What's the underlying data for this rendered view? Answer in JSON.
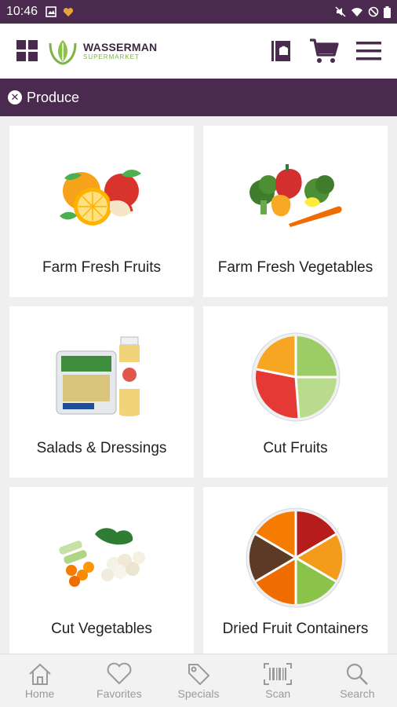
{
  "status_bar": {
    "time": "10:46"
  },
  "header": {
    "logo_name": "WASSERMAN",
    "logo_sub": "SUPERMARKET"
  },
  "breadcrumb": {
    "label": "Produce"
  },
  "categories": [
    {
      "label": "Farm Fresh Fruits"
    },
    {
      "label": "Farm Fresh Vegetables"
    },
    {
      "label": "Salads & Dressings"
    },
    {
      "label": "Cut Fruits"
    },
    {
      "label": "Cut Vegetables"
    },
    {
      "label": "Dried Fruit Containers"
    }
  ],
  "bottom_nav": [
    {
      "label": "Home",
      "icon": "home-icon"
    },
    {
      "label": "Favorites",
      "icon": "heart-icon"
    },
    {
      "label": "Specials",
      "icon": "tag-icon"
    },
    {
      "label": "Scan",
      "icon": "barcode-icon"
    },
    {
      "label": "Search",
      "icon": "search-icon"
    }
  ],
  "colors": {
    "brand": "#4a2a4e",
    "accent_green": "#7cb342"
  }
}
